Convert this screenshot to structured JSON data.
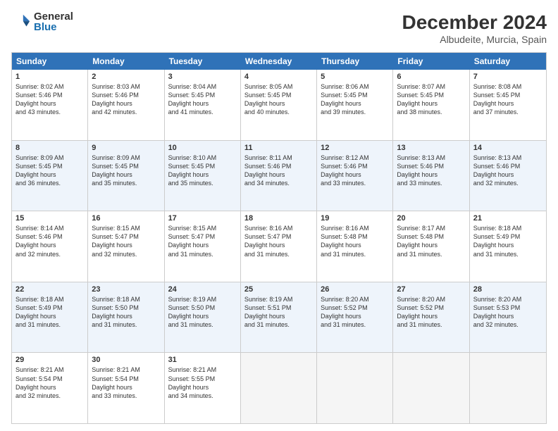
{
  "logo": {
    "general": "General",
    "blue": "Blue"
  },
  "title": "December 2024",
  "subtitle": "Albudeite, Murcia, Spain",
  "days": [
    "Sunday",
    "Monday",
    "Tuesday",
    "Wednesday",
    "Thursday",
    "Friday",
    "Saturday"
  ],
  "weeks": [
    [
      {
        "num": "1",
        "rise": "8:02 AM",
        "set": "5:46 PM",
        "daylight": "9 hours and 43 minutes."
      },
      {
        "num": "2",
        "rise": "8:03 AM",
        "set": "5:46 PM",
        "daylight": "9 hours and 42 minutes."
      },
      {
        "num": "3",
        "rise": "8:04 AM",
        "set": "5:45 PM",
        "daylight": "9 hours and 41 minutes."
      },
      {
        "num": "4",
        "rise": "8:05 AM",
        "set": "5:45 PM",
        "daylight": "9 hours and 40 minutes."
      },
      {
        "num": "5",
        "rise": "8:06 AM",
        "set": "5:45 PM",
        "daylight": "9 hours and 39 minutes."
      },
      {
        "num": "6",
        "rise": "8:07 AM",
        "set": "5:45 PM",
        "daylight": "9 hours and 38 minutes."
      },
      {
        "num": "7",
        "rise": "8:08 AM",
        "set": "5:45 PM",
        "daylight": "9 hours and 37 minutes."
      }
    ],
    [
      {
        "num": "8",
        "rise": "8:09 AM",
        "set": "5:45 PM",
        "daylight": "9 hours and 36 minutes."
      },
      {
        "num": "9",
        "rise": "8:09 AM",
        "set": "5:45 PM",
        "daylight": "9 hours and 35 minutes."
      },
      {
        "num": "10",
        "rise": "8:10 AM",
        "set": "5:45 PM",
        "daylight": "9 hours and 35 minutes."
      },
      {
        "num": "11",
        "rise": "8:11 AM",
        "set": "5:46 PM",
        "daylight": "9 hours and 34 minutes."
      },
      {
        "num": "12",
        "rise": "8:12 AM",
        "set": "5:46 PM",
        "daylight": "9 hours and 33 minutes."
      },
      {
        "num": "13",
        "rise": "8:13 AM",
        "set": "5:46 PM",
        "daylight": "9 hours and 33 minutes."
      },
      {
        "num": "14",
        "rise": "8:13 AM",
        "set": "5:46 PM",
        "daylight": "9 hours and 32 minutes."
      }
    ],
    [
      {
        "num": "15",
        "rise": "8:14 AM",
        "set": "5:46 PM",
        "daylight": "9 hours and 32 minutes."
      },
      {
        "num": "16",
        "rise": "8:15 AM",
        "set": "5:47 PM",
        "daylight": "9 hours and 32 minutes."
      },
      {
        "num": "17",
        "rise": "8:15 AM",
        "set": "5:47 PM",
        "daylight": "9 hours and 31 minutes."
      },
      {
        "num": "18",
        "rise": "8:16 AM",
        "set": "5:47 PM",
        "daylight": "9 hours and 31 minutes."
      },
      {
        "num": "19",
        "rise": "8:16 AM",
        "set": "5:48 PM",
        "daylight": "9 hours and 31 minutes."
      },
      {
        "num": "20",
        "rise": "8:17 AM",
        "set": "5:48 PM",
        "daylight": "9 hours and 31 minutes."
      },
      {
        "num": "21",
        "rise": "8:18 AM",
        "set": "5:49 PM",
        "daylight": "9 hours and 31 minutes."
      }
    ],
    [
      {
        "num": "22",
        "rise": "8:18 AM",
        "set": "5:49 PM",
        "daylight": "9 hours and 31 minutes."
      },
      {
        "num": "23",
        "rise": "8:18 AM",
        "set": "5:50 PM",
        "daylight": "9 hours and 31 minutes."
      },
      {
        "num": "24",
        "rise": "8:19 AM",
        "set": "5:50 PM",
        "daylight": "9 hours and 31 minutes."
      },
      {
        "num": "25",
        "rise": "8:19 AM",
        "set": "5:51 PM",
        "daylight": "9 hours and 31 minutes."
      },
      {
        "num": "26",
        "rise": "8:20 AM",
        "set": "5:52 PM",
        "daylight": "9 hours and 31 minutes."
      },
      {
        "num": "27",
        "rise": "8:20 AM",
        "set": "5:52 PM",
        "daylight": "9 hours and 31 minutes."
      },
      {
        "num": "28",
        "rise": "8:20 AM",
        "set": "5:53 PM",
        "daylight": "9 hours and 32 minutes."
      }
    ],
    [
      {
        "num": "29",
        "rise": "8:21 AM",
        "set": "5:54 PM",
        "daylight": "9 hours and 32 minutes."
      },
      {
        "num": "30",
        "rise": "8:21 AM",
        "set": "5:54 PM",
        "daylight": "9 hours and 33 minutes."
      },
      {
        "num": "31",
        "rise": "8:21 AM",
        "set": "5:55 PM",
        "daylight": "9 hours and 34 minutes."
      },
      null,
      null,
      null,
      null
    ]
  ]
}
